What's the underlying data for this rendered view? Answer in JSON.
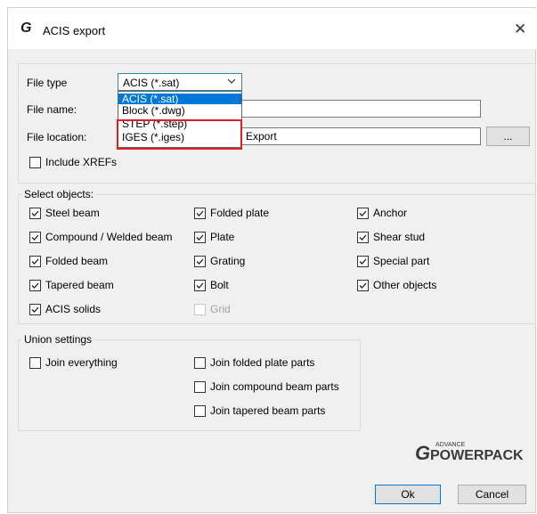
{
  "window": {
    "title": "ACIS export",
    "logo_glyph": "G",
    "close_glyph": "✕"
  },
  "file": {
    "type_label": "File type",
    "type_value": "ACIS (*.sat)",
    "type_options": [
      "ACIS (*.sat)",
      "Block (*.dwg)",
      "STEP (*.step)",
      "IGES (*.iges)"
    ],
    "name_label": "File name:",
    "name_value": "",
    "location_label": "File location:",
    "location_value": "Export",
    "browse_label": "...",
    "include_xrefs_label": "Include XREFs",
    "include_xrefs_checked": false
  },
  "select_objects": {
    "legend": "Select objects:",
    "items": [
      {
        "label": "Steel beam",
        "checked": true,
        "enabled": true
      },
      {
        "label": "Compound / Welded beam",
        "checked": true,
        "enabled": true
      },
      {
        "label": "Folded beam",
        "checked": true,
        "enabled": true
      },
      {
        "label": "Tapered beam",
        "checked": true,
        "enabled": true
      },
      {
        "label": "ACIS solids",
        "checked": true,
        "enabled": true
      },
      {
        "label": "Folded plate",
        "checked": true,
        "enabled": true
      },
      {
        "label": "Plate",
        "checked": true,
        "enabled": true
      },
      {
        "label": "Grating",
        "checked": true,
        "enabled": true
      },
      {
        "label": "Bolt",
        "checked": true,
        "enabled": true
      },
      {
        "label": "Grid",
        "checked": false,
        "enabled": false
      },
      {
        "label": "Anchor",
        "checked": true,
        "enabled": true
      },
      {
        "label": "Shear stud",
        "checked": true,
        "enabled": true
      },
      {
        "label": "Special part",
        "checked": true,
        "enabled": true
      },
      {
        "label": "Other objects",
        "checked": true,
        "enabled": true
      }
    ]
  },
  "union_settings": {
    "legend": "Union settings",
    "items": [
      {
        "label": "Join everything",
        "checked": false
      },
      {
        "label": "Join folded plate parts",
        "checked": false
      },
      {
        "label": "Join compound beam parts",
        "checked": false
      },
      {
        "label": "Join tapered beam parts",
        "checked": false
      }
    ]
  },
  "brand": {
    "small_text": "ADVANCE",
    "large_text": "POWERPACK",
    "glyph": "G"
  },
  "buttons": {
    "ok": "Ok",
    "cancel": "Cancel"
  },
  "colors": {
    "selection": "#0078d7",
    "highlight_box": "#e02020",
    "dialog_bg": "#f0f0f0"
  }
}
